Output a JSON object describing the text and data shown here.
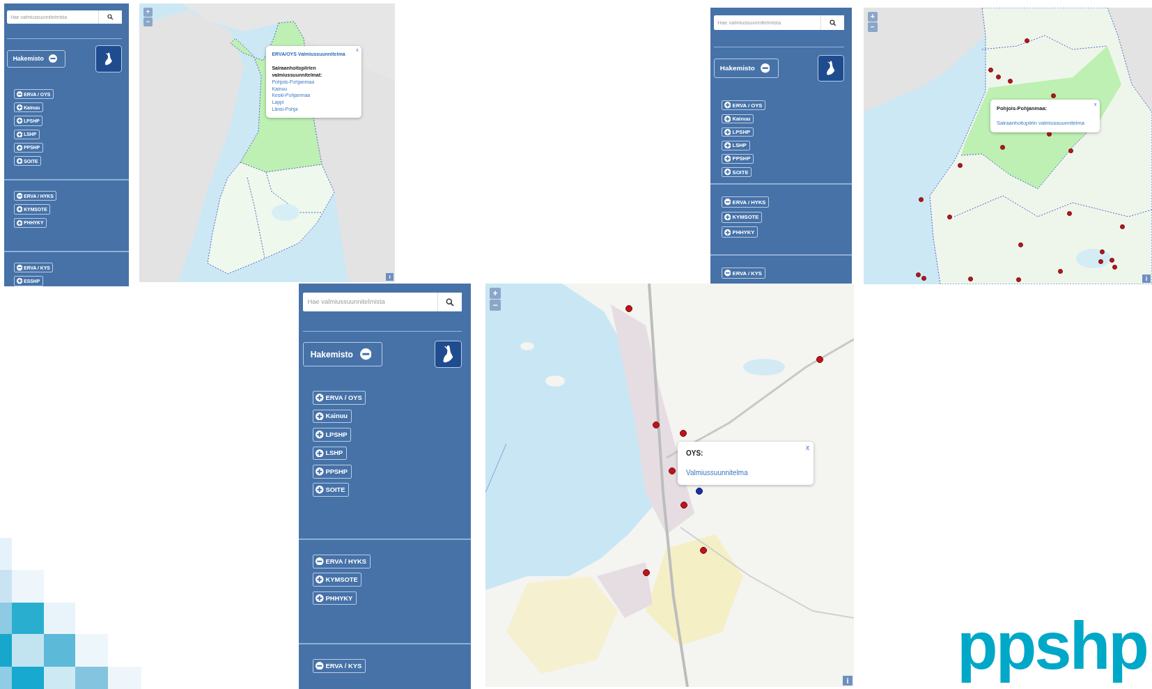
{
  "screenshots": [
    {
      "sidebar": {
        "search": {
          "placeholder": "Hae valmiussuunnitelmista"
        },
        "directory_button": {
          "label": "Hakemisto",
          "expanded": true
        },
        "groups": [
          {
            "items": [
              {
                "label": "ERVA / OYS",
                "expanded": true
              },
              {
                "label": "Kainuu",
                "expanded": false
              },
              {
                "label": "LPSHP",
                "expanded": false
              },
              {
                "label": "LSHP",
                "expanded": false
              },
              {
                "label": "PPSHP",
                "expanded": false
              },
              {
                "label": "SOITE",
                "expanded": false
              }
            ]
          },
          {
            "items": [
              {
                "label": "ERVA / HYKS",
                "expanded": true
              },
              {
                "label": "KYMSOTE",
                "expanded": false
              },
              {
                "label": "PHHYKY",
                "expanded": false
              }
            ]
          },
          {
            "items": [
              {
                "label": "ERVA / KYS",
                "expanded": true
              },
              {
                "label": "ESSHP",
                "expanded": false
              }
            ]
          }
        ]
      },
      "map": {
        "zoom_in": "+",
        "zoom_out": "−",
        "info": "i",
        "popup": {
          "close": "x",
          "title": "ERVA/OYS Valmiussuunnitelma",
          "heading": "Sairaanhoitopiirien valmiussuunnitelmat:",
          "links": [
            "Pohjois-Pohjanmaa",
            "Kainuu",
            "Keski-Pohjanmaa",
            "Lappi",
            "Länsi-Pohja"
          ]
        }
      }
    },
    {
      "sidebar": {
        "search": {
          "placeholder": "Hae valmiussuunnitelmista"
        },
        "directory_button": {
          "label": "Hakemisto",
          "expanded": true
        },
        "groups": [
          {
            "items": [
              {
                "label": "ERVA / OYS",
                "expanded": false
              },
              {
                "label": "Kainuu",
                "expanded": false
              },
              {
                "label": "LPSHP",
                "expanded": false
              },
              {
                "label": "LSHP",
                "expanded": false
              },
              {
                "label": "PPSHP",
                "expanded": false
              },
              {
                "label": "SOITE",
                "expanded": false
              }
            ]
          },
          {
            "items": [
              {
                "label": "ERVA / HYKS",
                "expanded": true
              },
              {
                "label": "KYMSOTE",
                "expanded": false
              },
              {
                "label": "PHHYKY",
                "expanded": false
              }
            ]
          },
          {
            "items": [
              {
                "label": "ERVA / KYS",
                "expanded": true
              }
            ]
          }
        ]
      },
      "map": {
        "zoom_in": "+",
        "zoom_out": "−",
        "info": "i",
        "popup": {
          "close": "x",
          "heading": "Pohjois-Pohjanmaa:",
          "links": [
            "Sairaanhoitopiirin valmiussuunnitelma"
          ]
        }
      }
    },
    {
      "sidebar": {
        "search": {
          "placeholder": "Hae valmiussuunnitelmista"
        },
        "directory_button": {
          "label": "Hakemisto",
          "expanded": true
        },
        "groups": [
          {
            "items": [
              {
                "label": "ERVA / OYS",
                "expanded": false
              },
              {
                "label": "Kainuu",
                "expanded": false
              },
              {
                "label": "LPSHP",
                "expanded": false
              },
              {
                "label": "LSHP",
                "expanded": false
              },
              {
                "label": "PPSHP",
                "expanded": false
              },
              {
                "label": "SOITE",
                "expanded": false
              }
            ]
          },
          {
            "items": [
              {
                "label": "ERVA / HYKS",
                "expanded": true
              },
              {
                "label": "KYMSOTE",
                "expanded": false
              },
              {
                "label": "PHHYKY",
                "expanded": false
              }
            ]
          },
          {
            "items": [
              {
                "label": "ERVA / KYS",
                "expanded": true
              }
            ]
          }
        ]
      },
      "map": {
        "zoom_in": "+",
        "zoom_out": "−",
        "info": "i",
        "popup": {
          "close": "x",
          "heading": "OYS:",
          "links": [
            "Valmiussuunnitelma"
          ]
        }
      }
    }
  ],
  "logo": "ppshp"
}
